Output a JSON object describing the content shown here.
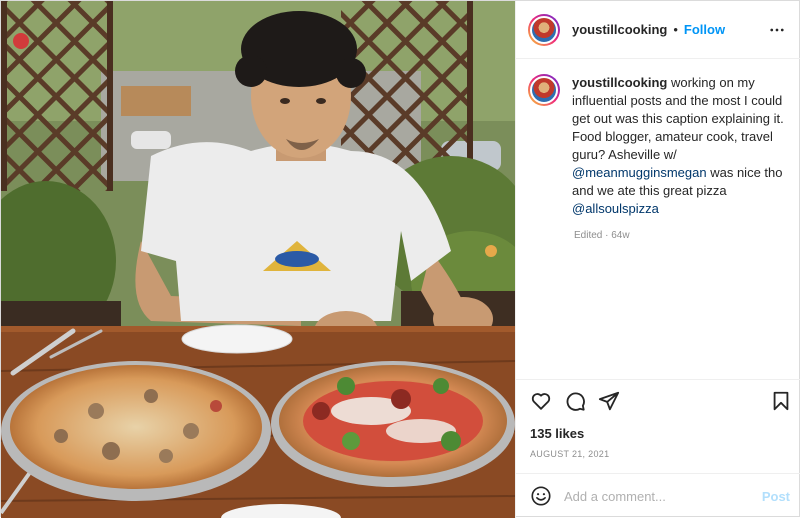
{
  "post": {
    "username": "youstillcooking",
    "follow_separator": "•",
    "follow_label": "Follow",
    "caption": {
      "username": "youstillcooking",
      "text_part1": " working on my influential posts and the most I could get out was this caption explaining it. Food blogger, amateur cook, travel guru? Asheville w/ ",
      "mention1": "@meanmugginsmegan",
      "text_part2": " was nice tho and we ate this great pizza ",
      "mention2": "@allsoulspizza"
    },
    "edited_label": "Edited · 64w",
    "likes": "135 likes",
    "date": "AUGUST 21, 2021",
    "comment_placeholder": "Add a comment...",
    "post_label": "Post"
  },
  "icons": {
    "more": "more-icon",
    "heart": "heart-icon",
    "comment": "comment-icon",
    "share": "share-icon",
    "save": "bookmark-icon",
    "emoji": "emoji-icon"
  },
  "colors": {
    "accent": "#0095f6",
    "muted": "#8e8e8e",
    "post_disabled": "#b2dffc",
    "mention": "#00376b"
  }
}
